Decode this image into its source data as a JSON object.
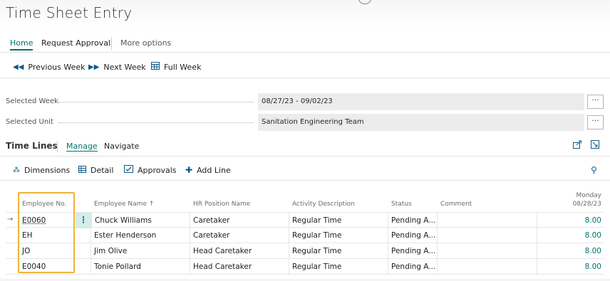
{
  "page": {
    "title": "Time Sheet Entry"
  },
  "actionbar": {
    "tabs": [
      {
        "label": "Home",
        "active": true
      },
      {
        "label": "Request Approval",
        "active": false
      }
    ],
    "more": "More options"
  },
  "subbar": {
    "previous_week": "Previous Week",
    "next_week": "Next Week",
    "full_week": "Full Week"
  },
  "fields": {
    "selected_week": {
      "label": "Selected Week",
      "value": "08/27/23 - 09/02/23",
      "button": "···"
    },
    "selected_unit": {
      "label": "Selected Unit",
      "value": "Sanitation Engineering Team",
      "button": "···"
    }
  },
  "lines": {
    "title": "Time Lines",
    "tabs": [
      {
        "label": "Manage",
        "active": true
      },
      {
        "label": "Navigate",
        "active": false
      }
    ],
    "actions": {
      "dimensions": "Dimensions",
      "detail": "Detail",
      "approvals": "Approvals",
      "add_line": "Add Line"
    }
  },
  "grid": {
    "columns": {
      "employee_no": "Employee No.",
      "employee_name": "Employee Name ↑",
      "hr_position": "HR Position Name",
      "activity": "Activity Description",
      "status": "Status",
      "comment": "Comment",
      "day_name": "Monday",
      "day_date": "08/28/23"
    },
    "rows": [
      {
        "no": "E0060",
        "name": "Chuck Williams",
        "position": "Caretaker",
        "activity": "Regular Time",
        "status": "Pending A...",
        "comment": "",
        "hours": "8.00"
      },
      {
        "no": "EH",
        "name": "Ester Henderson",
        "position": "Caretaker",
        "activity": "Regular Time",
        "status": "Pending A...",
        "comment": "",
        "hours": "8.00"
      },
      {
        "no": "JO",
        "name": "Jim Olive",
        "position": "Head Caretaker",
        "activity": "Regular Time",
        "status": "Pending A...",
        "comment": "",
        "hours": "8.00"
      },
      {
        "no": "E0040",
        "name": "Tonie Pollard",
        "position": "Head Caretaker",
        "activity": "Regular Time",
        "status": "Pending A...",
        "comment": "",
        "hours": "8.00"
      }
    ]
  },
  "colors": {
    "accent": "#00716b",
    "highlight": "#f0b336",
    "icon": "#0b5a87"
  }
}
